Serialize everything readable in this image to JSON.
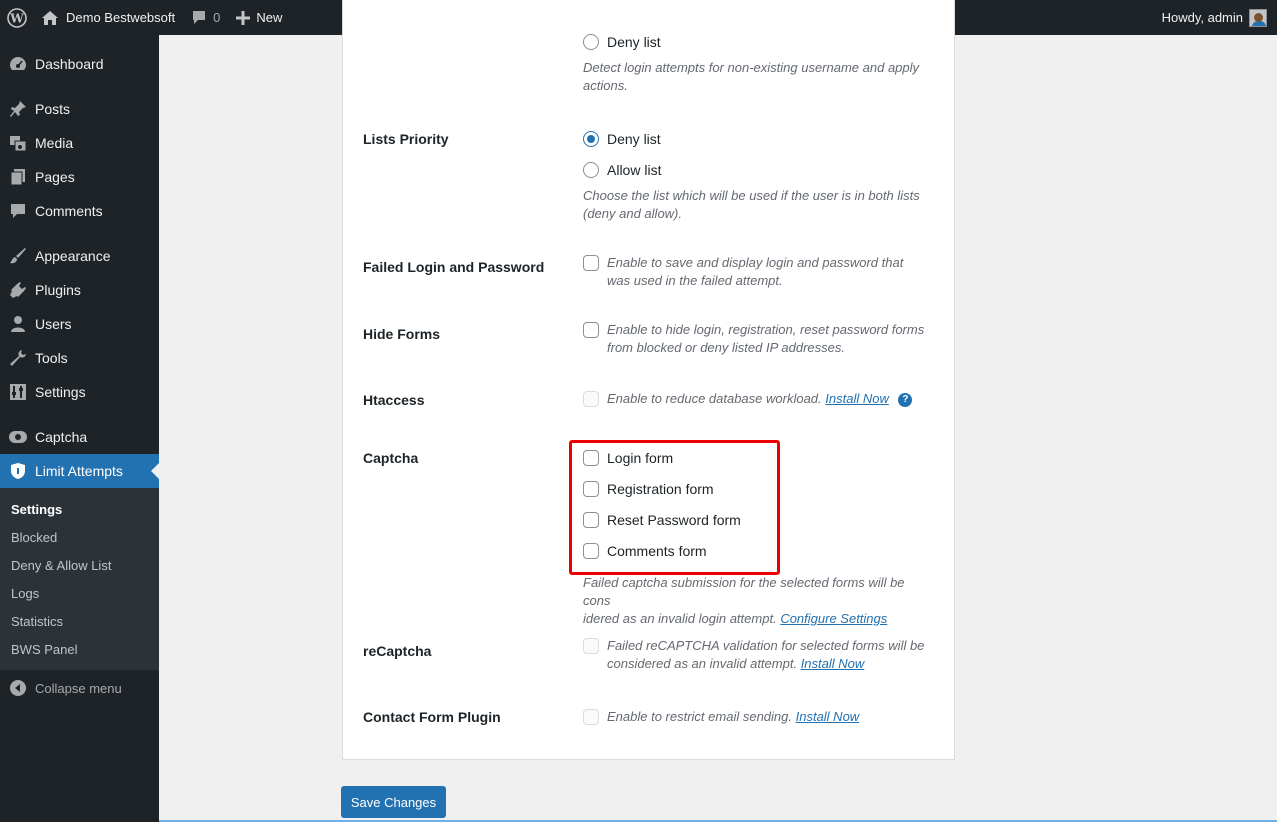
{
  "adminbar": {
    "site_name": "Demo Bestwebsoft",
    "comments_count": "0",
    "new_label": "New",
    "howdy": "Howdy, admin"
  },
  "sidebar": {
    "items": [
      {
        "label": "Dashboard",
        "icon": "dashboard-icon"
      },
      {
        "label": "Posts",
        "icon": "pin-icon"
      },
      {
        "label": "Media",
        "icon": "media-icon"
      },
      {
        "label": "Pages",
        "icon": "pages-icon"
      },
      {
        "label": "Comments",
        "icon": "comment-icon"
      },
      {
        "label": "Appearance",
        "icon": "brush-icon"
      },
      {
        "label": "Plugins",
        "icon": "plug-icon"
      },
      {
        "label": "Users",
        "icon": "user-icon"
      },
      {
        "label": "Tools",
        "icon": "wrench-icon"
      },
      {
        "label": "Settings",
        "icon": "sliders-icon"
      },
      {
        "label": "Captcha",
        "icon": "captcha-icon"
      },
      {
        "label": "Limit Attempts",
        "icon": "shield-icon"
      }
    ],
    "submenu": [
      "Settings",
      "Blocked",
      "Deny & Allow List",
      "Logs",
      "Statistics",
      "BWS Panel"
    ],
    "collapse": "Collapse menu"
  },
  "form": {
    "top_radio": "Deny list",
    "top_desc": "Detect login attempts for non-existing username and apply actions.",
    "lists_priority": {
      "label": "Lists Priority",
      "options": [
        "Deny list",
        "Allow list"
      ],
      "selected": "Deny list",
      "desc": "Choose the list which will be used if the user is in both lists (deny and allow)."
    },
    "failed_login": {
      "label": "Failed Login and Password",
      "text": "Enable to save and display login and password that was used in the failed attempt."
    },
    "hide_forms": {
      "label": "Hide Forms",
      "text": "Enable to hide login, registration, reset password forms from blocked or deny listed IP addresses."
    },
    "htaccess": {
      "label": "Htaccess",
      "text": "Enable to reduce database workload.",
      "link": "Install Now",
      "help": "?"
    },
    "captcha": {
      "label": "Captcha",
      "options": [
        "Login form",
        "Registration form",
        "Reset Password form",
        "Comments form"
      ],
      "desc_line1": "Failed captcha submission for the selected forms will be cons",
      "desc_line2": "idered as an invalid login attempt.",
      "link": "Configure Settings"
    },
    "recaptcha": {
      "label": "reCaptcha",
      "text_line1": "Failed reCAPTCHA validation for selected forms will be",
      "text_line2": "considered as an invalid attempt.",
      "link": "Install Now"
    },
    "contact_form": {
      "label": "Contact Form Plugin",
      "text": "Enable to restrict email sending.",
      "link": "Install Now"
    },
    "save_label": "Save Changes"
  },
  "colors": {
    "accent": "#2271b1",
    "highlight": "#ee0000",
    "sidebar": "#1d2327"
  }
}
